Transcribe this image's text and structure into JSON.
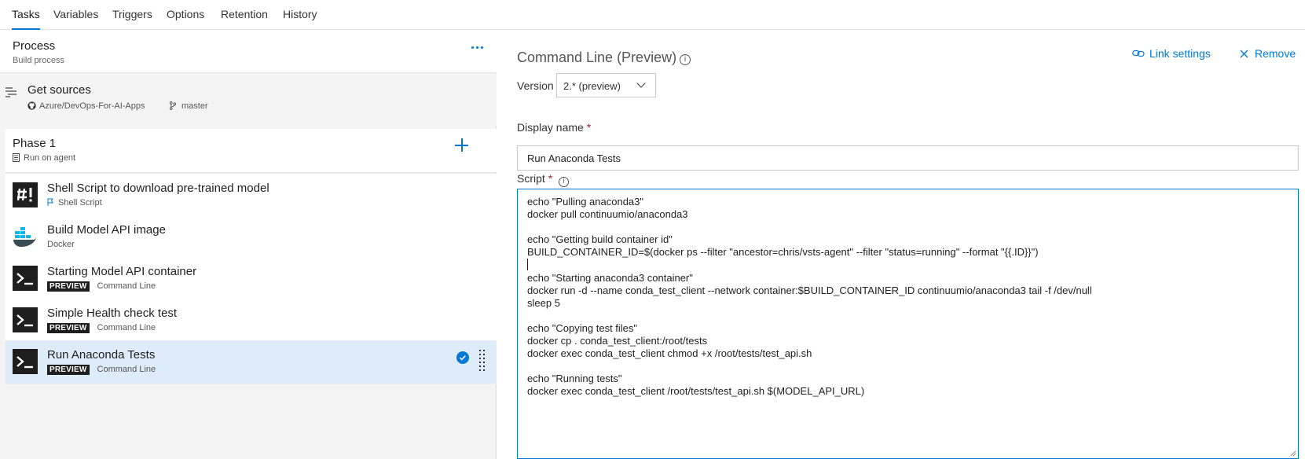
{
  "tabs": [
    "Tasks",
    "Variables",
    "Triggers",
    "Options",
    "Retention",
    "History"
  ],
  "process": {
    "title": "Process",
    "subtitle": "Build process"
  },
  "sources": {
    "title": "Get sources",
    "repo": "Azure/DevOps-For-AI-Apps",
    "branch": "master"
  },
  "phase": {
    "title": "Phase 1",
    "subtitle": "Run on agent"
  },
  "tasks": [
    {
      "title": "Shell Script to download pre-trained model",
      "subtitle": "Shell Script",
      "icon": "shell-script-icon"
    },
    {
      "title": "Build Model API image",
      "subtitle": "Docker",
      "icon": "docker-icon"
    },
    {
      "title": "Starting Model API container",
      "badge": "PREVIEW",
      "subtitle": "Command Line",
      "icon": "terminal-icon"
    },
    {
      "title": "Simple Health check test",
      "badge": "PREVIEW",
      "subtitle": "Command Line",
      "icon": "terminal-icon"
    },
    {
      "title": "Run Anaconda Tests",
      "badge": "PREVIEW",
      "subtitle": "Command Line",
      "icon": "terminal-icon",
      "selected": true
    }
  ],
  "detail": {
    "title": "Command Line (Preview)",
    "link_settings": "Link settings",
    "remove": "Remove",
    "version_label": "Version",
    "version_value": "2.* (preview)",
    "display_name_label": "Display name",
    "display_name_value": "Run Anaconda Tests",
    "script_label": "Script",
    "required_mark": "*",
    "script_lines": [
      "echo \"Pulling anaconda3\"",
      "docker pull continuumio/anaconda3",
      "",
      "echo \"Getting build container id\"",
      "BUILD_CONTAINER_ID=$(docker ps --filter \"ancestor=chris/vsts-agent\" --filter \"status=running\" --format \"{{.ID}}\")",
      "",
      "echo \"Starting anaconda3 container\"",
      "docker run -d --name conda_test_client --network container:$BUILD_CONTAINER_ID continuumio/anaconda3 tail -f /dev/null",
      "sleep 5",
      "",
      "echo \"Copying test files\"",
      "docker cp . conda_test_client:/root/tests",
      "docker exec conda_test_client chmod +x /root/tests/test_api.sh",
      "",
      "echo \"Running tests\"",
      "docker exec conda_test_client /root/tests/test_api.sh $(MODEL_API_URL)"
    ]
  },
  "colors": {
    "accent": "#0078d4",
    "selected_row": "#deecf9",
    "required": "#a4262c"
  }
}
